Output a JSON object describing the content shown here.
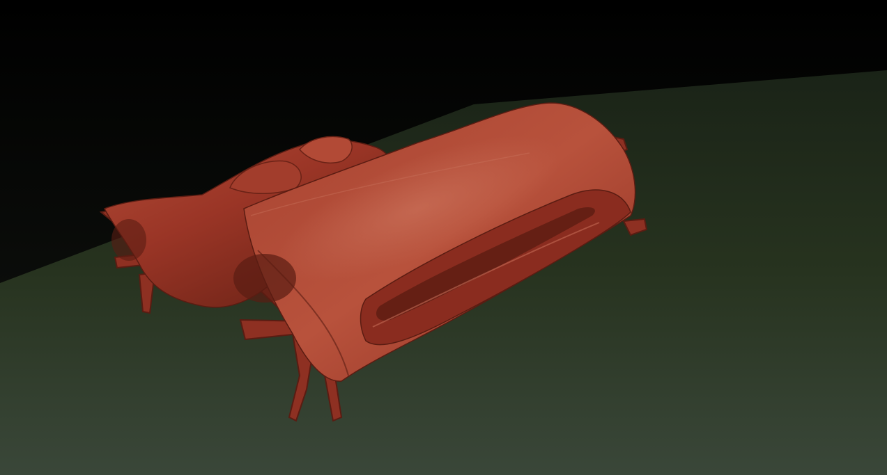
{
  "viewport": {
    "background_color": "#000000",
    "ground_top_color": "#1a2317",
    "ground_bottom_color": "#3a4739",
    "model_color": "#9a3526",
    "model_highlight_color": "#c46a55",
    "model_shadow_color": "#5a1c12"
  }
}
